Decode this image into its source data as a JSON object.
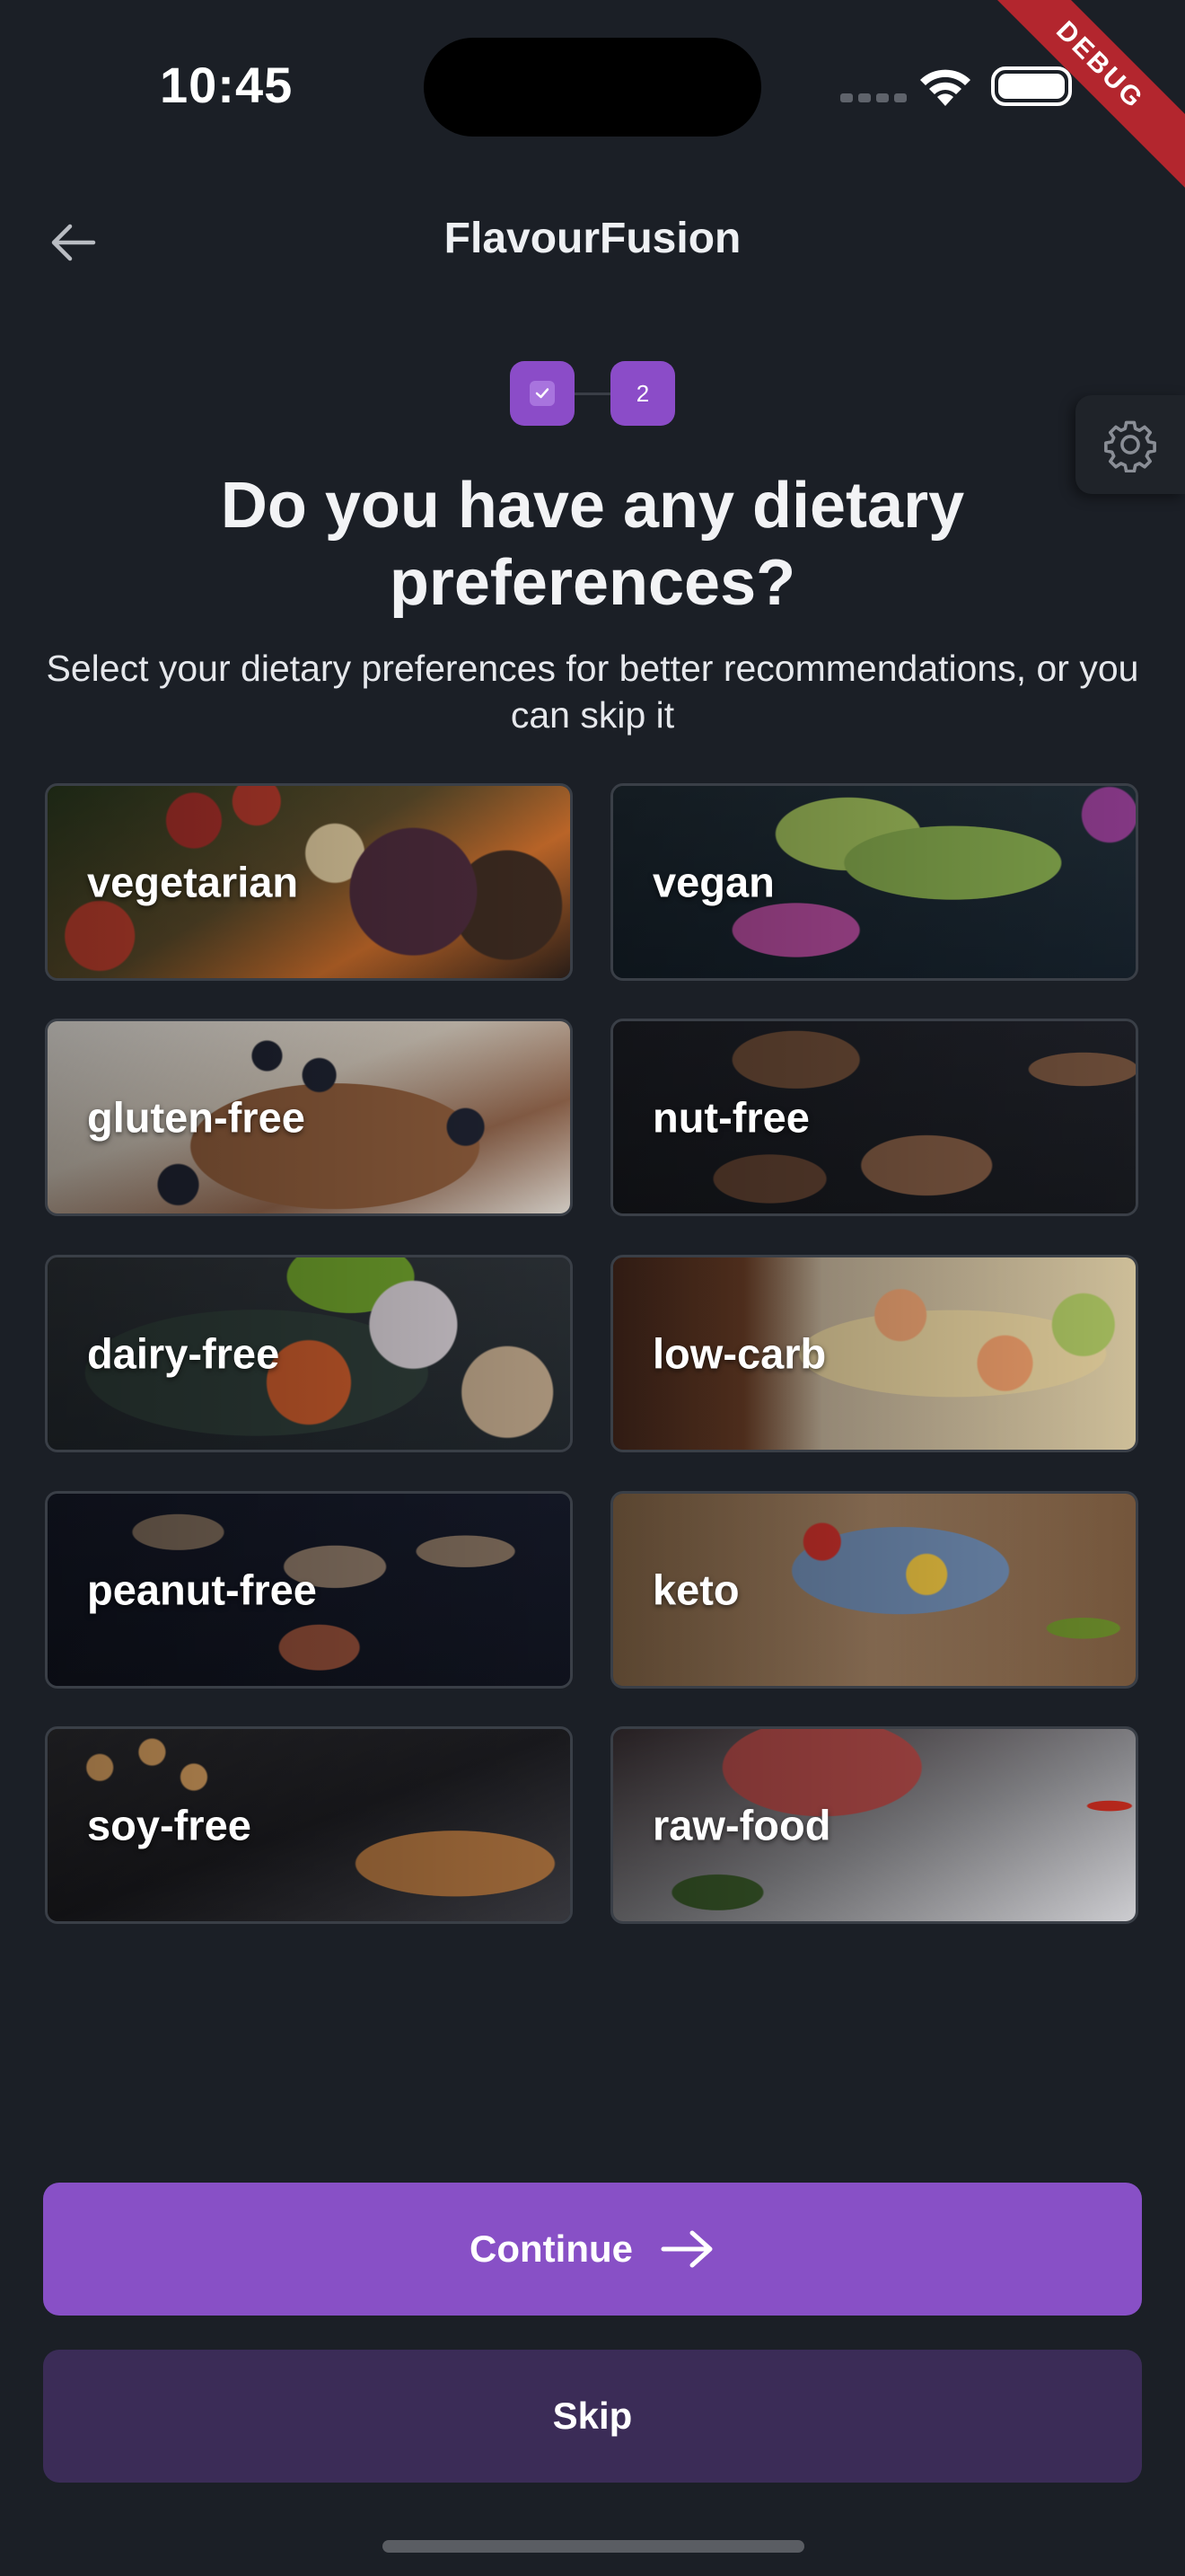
{
  "status_bar": {
    "time": "10:45",
    "debug_banner": "DEBUG"
  },
  "app_bar": {
    "title": "FlavourFusion",
    "back_icon": "arrow-left-icon",
    "settings_icon": "gear-icon"
  },
  "stepper": {
    "steps": [
      {
        "state": "completed",
        "icon": "check-icon"
      },
      {
        "label": "2"
      }
    ]
  },
  "page": {
    "heading": "Do you have any dietary preferences?",
    "subtitle": "Select your dietary preferences for better recommendations, or you can skip it"
  },
  "options": [
    {
      "label": "vegetarian"
    },
    {
      "label": "vegan"
    },
    {
      "label": "gluten-free"
    },
    {
      "label": "nut-free"
    },
    {
      "label": "dairy-free"
    },
    {
      "label": "low-carb"
    },
    {
      "label": "peanut-free"
    },
    {
      "label": "keto"
    },
    {
      "label": "soy-free"
    },
    {
      "label": "raw-food"
    }
  ],
  "actions": {
    "continue_label": "Continue",
    "continue_icon": "arrow-right-icon",
    "skip_label": "Skip"
  },
  "colors": {
    "background": "#1b1f26",
    "accent": "#8850c6",
    "skip_button": "#3b2c57",
    "debug_banner": "#b3262e"
  }
}
